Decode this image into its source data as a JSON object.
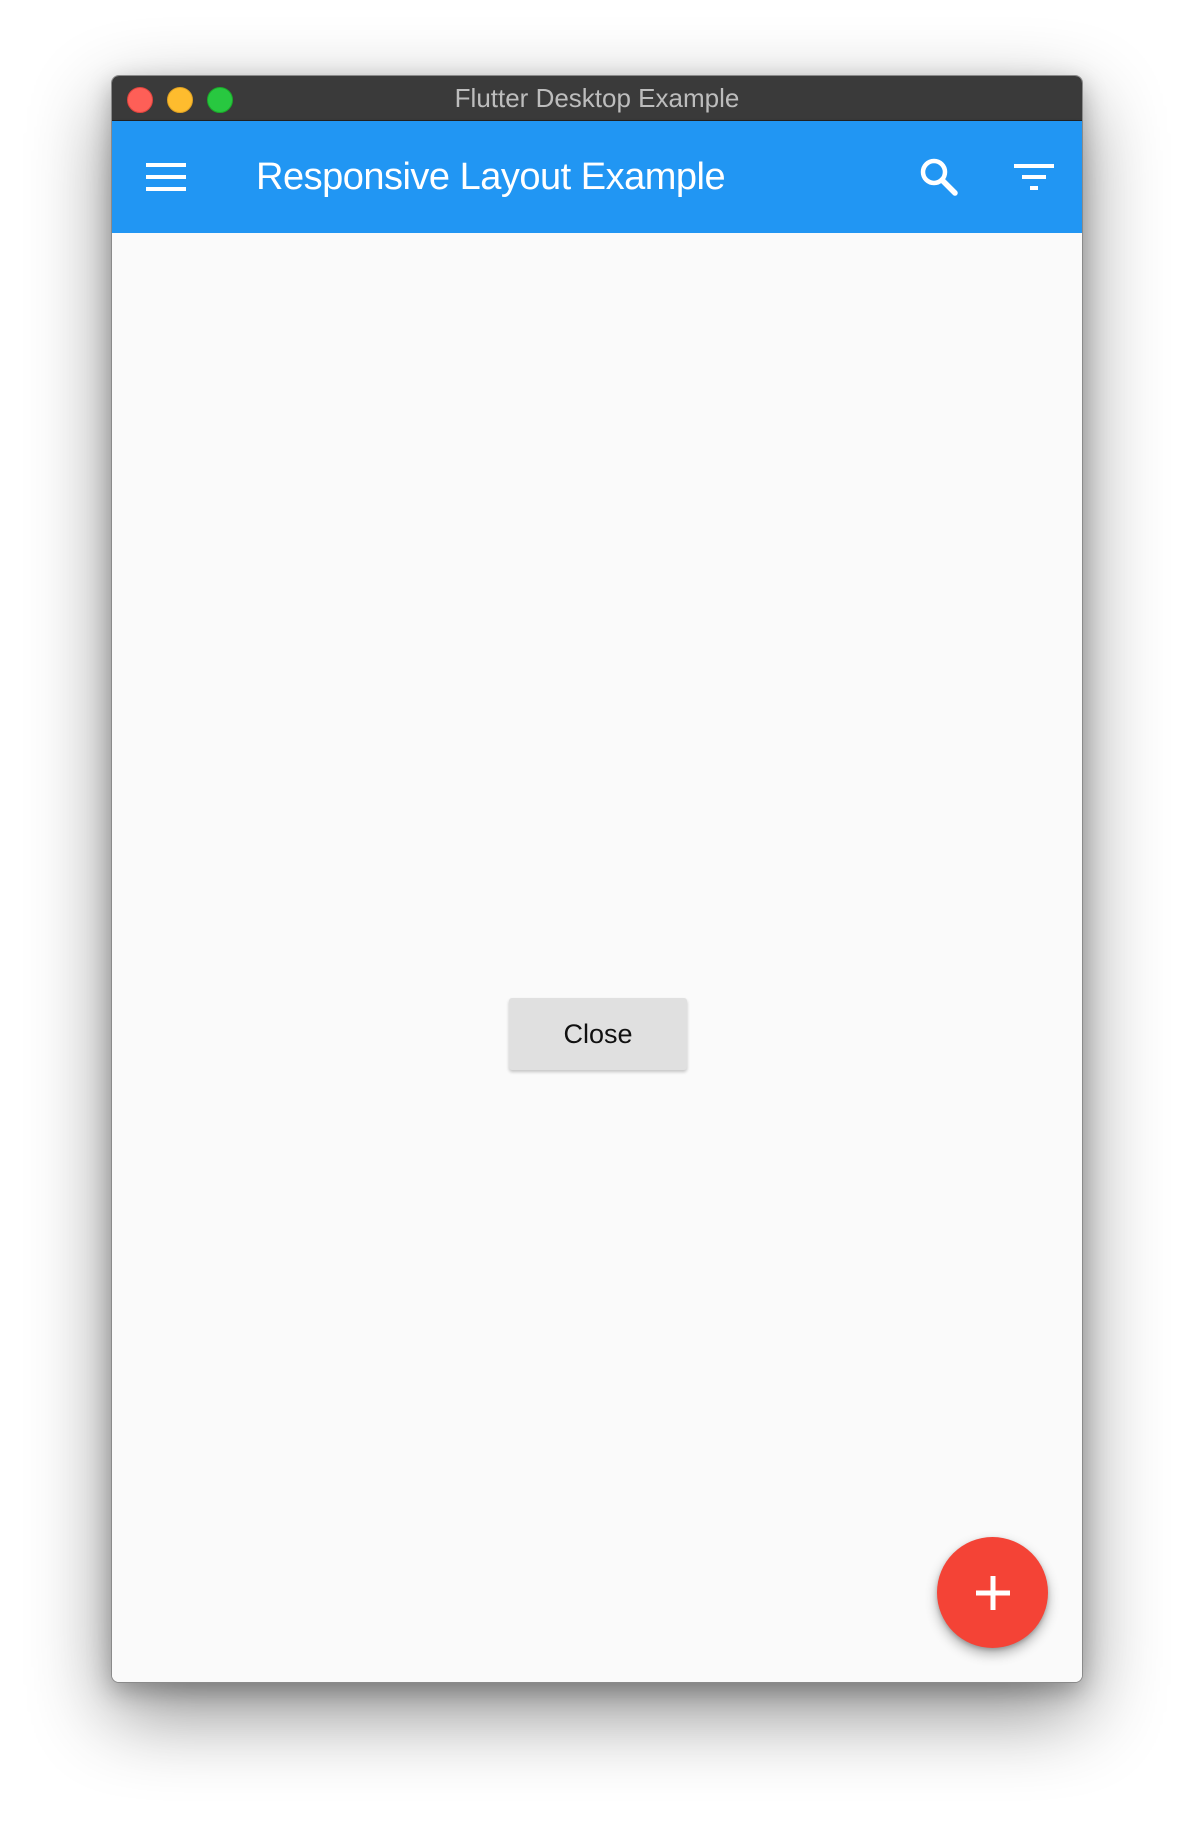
{
  "window": {
    "title": "Flutter Desktop Example"
  },
  "appbar": {
    "title": "Responsive Layout Example",
    "background": "#2196f3",
    "icons": {
      "menu": "hamburger-menu-icon",
      "search": "search-icon",
      "filter": "filter-icon"
    }
  },
  "content": {
    "close_label": "Close"
  },
  "fab": {
    "icon": "plus-icon",
    "color": "#f44336"
  }
}
